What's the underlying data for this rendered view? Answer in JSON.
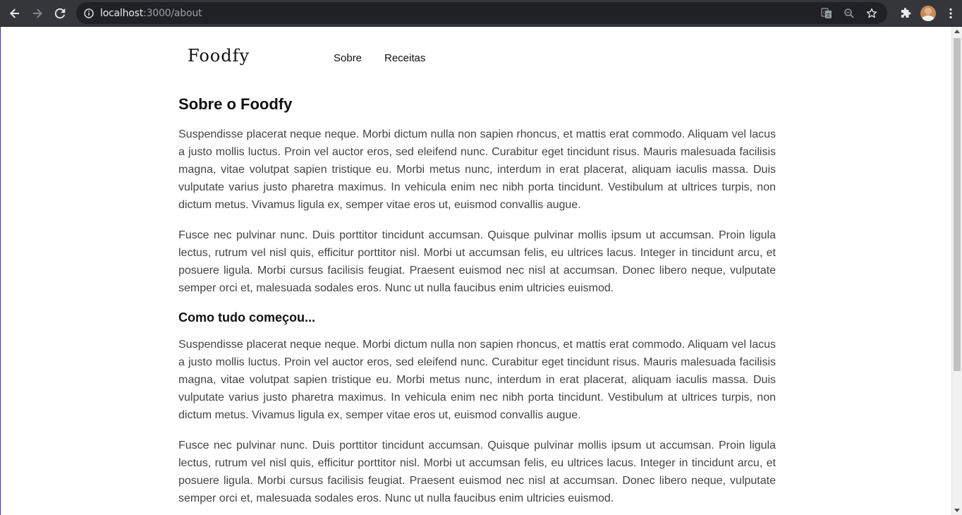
{
  "browser": {
    "url_host": "localhost",
    "url_path": ":3000/about",
    "icons": {
      "back": "arrow-left-icon",
      "forward": "arrow-right-icon",
      "reload": "reload-icon",
      "site_info": "info-icon",
      "translate": "translate-icon",
      "zoom": "zoom-icon",
      "bookmark": "star-icon",
      "extensions": "puzzle-icon",
      "profile": "avatar",
      "menu": "kebab-menu-icon"
    }
  },
  "header": {
    "logo": "Foodfy",
    "nav": [
      {
        "label": "Sobre"
      },
      {
        "label": "Receitas"
      }
    ]
  },
  "main": {
    "title": "Sobre o Foodfy",
    "paragraphs_intro": [
      "Suspendisse placerat neque neque. Morbi dictum nulla non sapien rhoncus, et mattis erat commodo. Aliquam vel lacus a justo mollis luctus. Proin vel auctor eros, sed eleifend nunc. Curabitur eget tincidunt risus. Mauris malesuada facilisis magna, vitae volutpat sapien tristique eu. Morbi metus nunc, interdum in erat placerat, aliquam iaculis massa. Duis vulputate varius justo pharetra maximus. In vehicula enim nec nibh porta tincidunt. Vestibulum at ultrices turpis, non dictum metus. Vivamus ligula ex, semper vitae eros ut, euismod convallis augue.",
      "Fusce nec pulvinar nunc. Duis porttitor tincidunt accumsan. Quisque pulvinar mollis ipsum ut accumsan. Proin ligula lectus, rutrum vel nisl quis, efficitur porttitor nisl. Morbi ut accumsan felis, eu ultrices lacus. Integer in tincidunt arcu, et posuere ligula. Morbi cursus facilisis feugiat. Praesent euismod nec nisl at accumsan. Donec libero neque, vulputate semper orci et, malesuada sodales eros. Nunc ut nulla faucibus enim ultricies euismod."
    ],
    "section_title": "Como tudo começou...",
    "paragraphs_section": [
      "Suspendisse placerat neque neque. Morbi dictum nulla non sapien rhoncus, et mattis erat commodo. Aliquam vel lacus a justo mollis luctus. Proin vel auctor eros, sed eleifend nunc. Curabitur eget tincidunt risus. Mauris malesuada facilisis magna, vitae volutpat sapien tristique eu. Morbi metus nunc, interdum in erat placerat, aliquam iaculis massa. Duis vulputate varius justo pharetra maximus. In vehicula enim nec nibh porta tincidunt. Vestibulum at ultrices turpis, non dictum metus. Vivamus ligula ex, semper vitae eros ut, euismod convallis augue.",
      "Fusce nec pulvinar nunc. Duis porttitor tincidunt accumsan. Quisque pulvinar mollis ipsum ut accumsan. Proin ligula lectus, rutrum vel nisl quis, efficitur porttitor nisl. Morbi ut accumsan felis, eu ultrices lacus. Integer in tincidunt arcu, et posuere ligula. Morbi cursus facilisis feugiat. Praesent euismod nec nisl at accumsan. Donec libero neque, vulputate semper orci et, malesuada sodales eros. Nunc ut nulla faucibus enim ultricies euismod."
    ]
  },
  "colors": {
    "browser_bar": "#35363a",
    "omnibox": "#202124",
    "heading_text": "#111111",
    "body_text": "#444444"
  }
}
